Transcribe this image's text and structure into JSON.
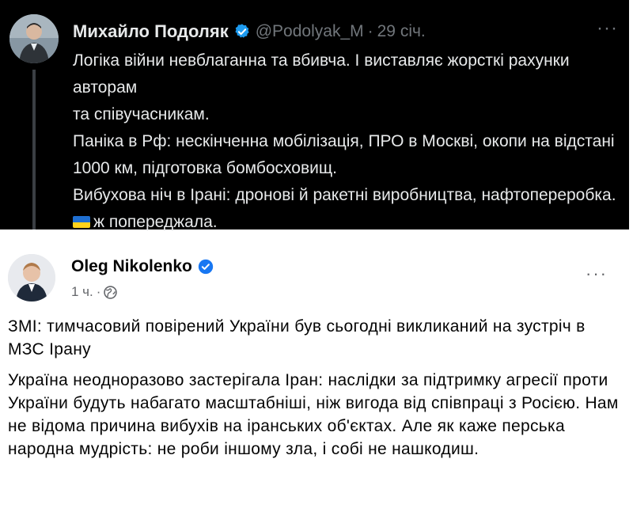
{
  "tweet": {
    "author_name": "Михайло Подоляк",
    "handle": "@Podolyak_M",
    "separator": "·",
    "time": "29 січ.",
    "more_label": "···",
    "lines": [
      "Логіка війни невблаганна та вбивча. І виставляє жорсткі рахунки авторам",
      "та співучасникам.",
      "Паніка в Рф: нескінченна мобілізація, ПРО в Москві, окопи на відстані",
      "1000 км, підготовка бомбосховищ.",
      "Вибухова ніч в Ірані: дронові й ракетні виробництва, нафтопереробка."
    ],
    "last_line": "ж попереджала.",
    "flag_icon": "ukraine-flag-icon",
    "colors": {
      "background": "#000000",
      "text": "#e7e9ea",
      "muted": "#71767b",
      "verified": "#1d9bf0"
    }
  },
  "facebook": {
    "author_name": "Oleg Nikolenko",
    "time": "1 ч.",
    "separator": "·",
    "audience_icon": "globe-icon",
    "more_label": "···",
    "paragraph1": "ЗМІ: тимчасовий повірений України був сьогодні викликаний на зустріч в МЗС Ірану",
    "paragraph2": "Україна неодноразово застерігала Іран: наслідки за підтримку агресії проти України будуть набагато масштабніші, ніж вигода від співпраці з Росією. Нам не відома причина вибухів на іранських об'єктах. Але як каже перська народна мудрість: не роби іншому зла, і собі не нашкодиш.",
    "colors": {
      "background": "#ffffff",
      "text": "#050505",
      "muted": "#65676b",
      "verified": "#1877f2"
    }
  }
}
